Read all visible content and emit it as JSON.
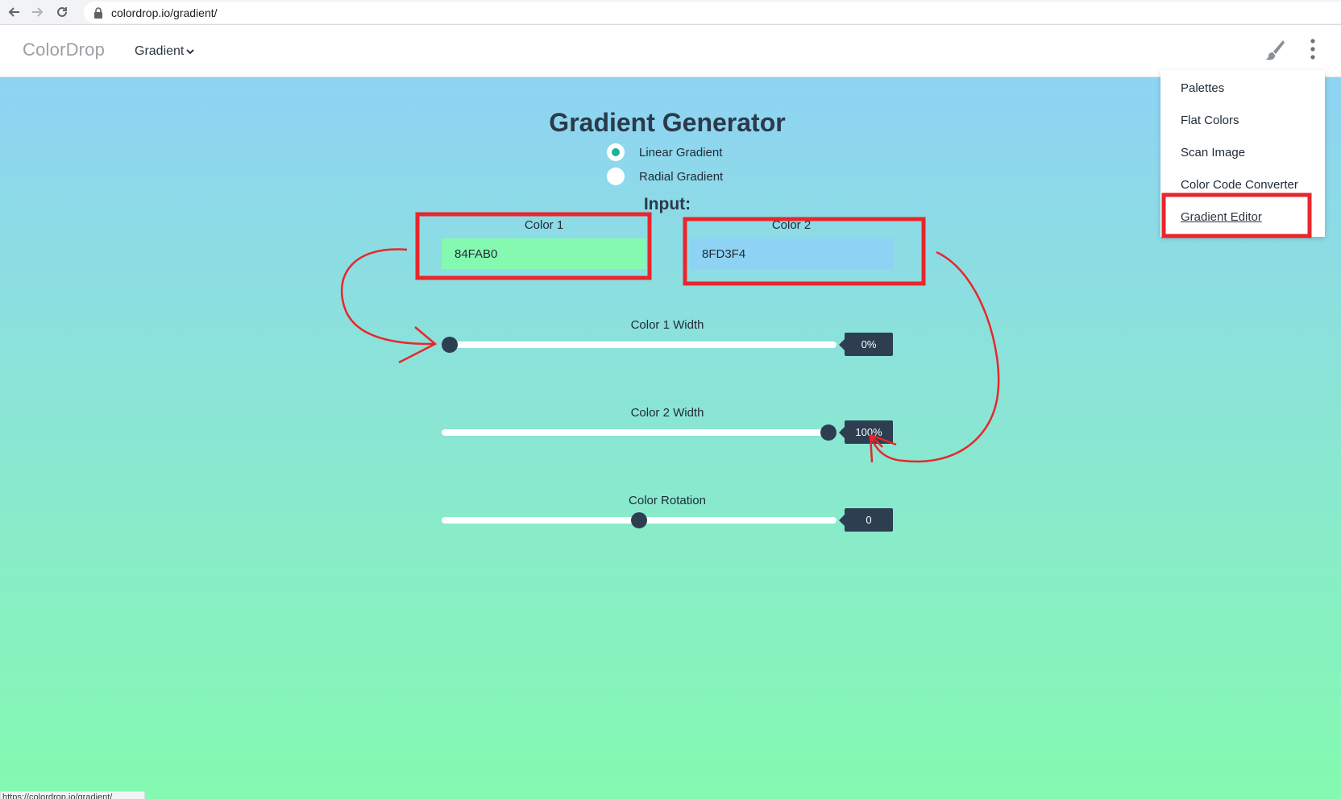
{
  "browser": {
    "url": "colordrop.io/gradient/",
    "status_url": "https://colordrop.io/gradient/"
  },
  "header": {
    "brand": "ColorDrop",
    "nav_label": "Gradient"
  },
  "main": {
    "title": "Gradient Generator",
    "gradient_types": [
      {
        "label": "Linear Gradient",
        "selected": true
      },
      {
        "label": "Radial Gradient",
        "selected": false
      }
    ],
    "input_heading": "Input:",
    "color1": {
      "label": "Color 1",
      "value": "84FAB0",
      "swatch": "#84FAB0"
    },
    "color2": {
      "label": "Color 2",
      "value": "8FD3F4",
      "swatch": "#8FD3F4"
    },
    "sliders": [
      {
        "label": "Color 1 Width",
        "value_text": "0%",
        "fraction": 0.0
      },
      {
        "label": "Color 2 Width",
        "value_text": "100%",
        "fraction": 1.0
      },
      {
        "label": "Color Rotation",
        "value_text": "0",
        "fraction": 0.5
      }
    ]
  },
  "menu": {
    "items": [
      "Palettes",
      "Flat Colors",
      "Scan Image",
      "Color Code Converter",
      "Gradient Editor"
    ],
    "active_item": "Gradient Editor"
  },
  "colors": {
    "accent": "#16b596",
    "dark": "#2d3e50",
    "annotation": "#e8262b"
  },
  "icons": [
    "back-arrow-icon",
    "forward-arrow-icon",
    "reload-icon",
    "lock-icon",
    "chevron-down-icon",
    "brush-icon",
    "kebab-menu-icon"
  ]
}
